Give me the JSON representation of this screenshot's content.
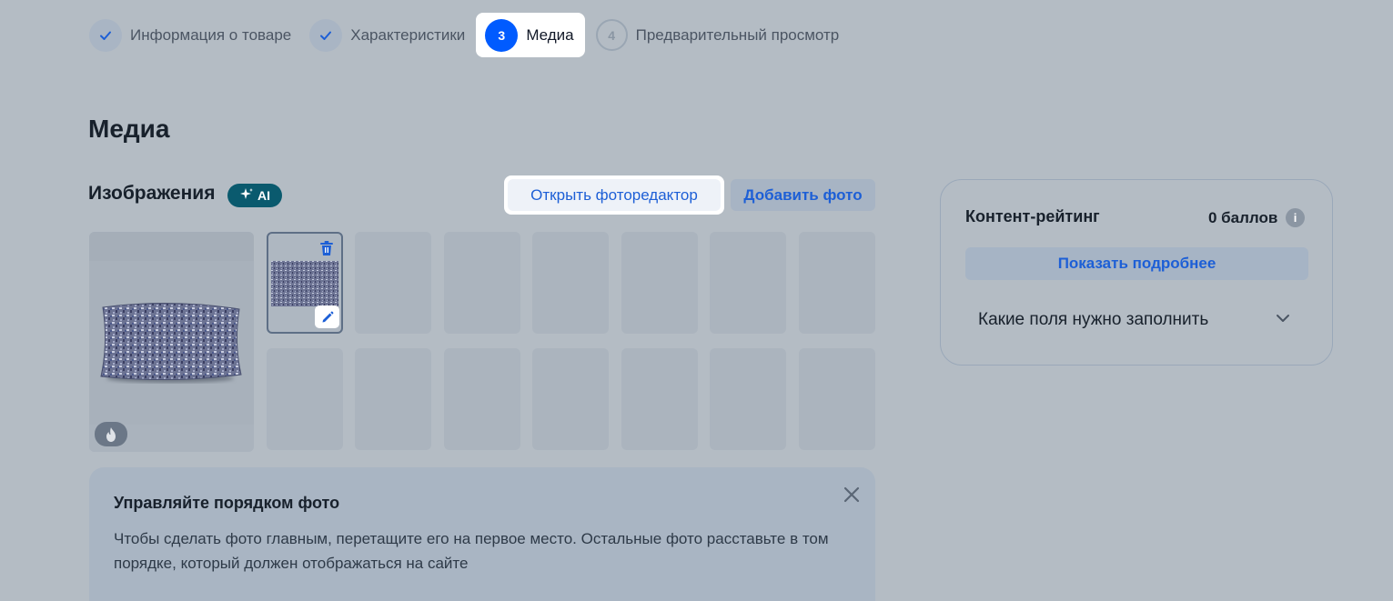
{
  "stepper": {
    "steps": [
      {
        "marker": "✓",
        "label": "Информация о товаре",
        "state": "done"
      },
      {
        "marker": "✓",
        "label": "Характеристики",
        "state": "done"
      },
      {
        "marker": "3",
        "label": "Медиа",
        "state": "active"
      },
      {
        "marker": "4",
        "label": "Предварительный просмотр",
        "state": "todo"
      }
    ]
  },
  "page": {
    "title": "Медиа"
  },
  "images": {
    "title": "Изображения",
    "ai_badge": "AI",
    "open_editor_label": "Открыть фоторедактор",
    "add_photo_label": "Добавить фото",
    "photo_count": 2,
    "empty_slots": 13
  },
  "hint": {
    "title": "Управляйте порядком фото",
    "text": "Чтобы сделать фото главным, перетащите его на первое место. Остальные фото расставьте в том порядке, который должен отображаться на сайте"
  },
  "rating": {
    "title": "Контент-рейтинг",
    "score": "0 баллов",
    "details_label": "Показать подробнее",
    "fields_label": "Какие поля нужно заполнить"
  },
  "colors": {
    "accent": "#005bff",
    "link": "#1d5fd6",
    "overlay_bg": "#b4bcc4",
    "ai_badge": "#0a5a6e"
  },
  "icons": [
    "check-icon",
    "sparkle-icon",
    "trash-icon",
    "pencil-icon",
    "fire-icon",
    "close-icon",
    "info-icon",
    "chevron-down-icon"
  ]
}
